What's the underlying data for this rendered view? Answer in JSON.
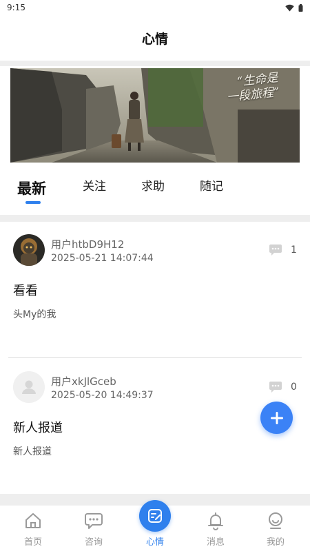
{
  "status_bar": {
    "time": "9:15",
    "wifi_icon": "wifi-icon",
    "battery_icon": "battery-icon"
  },
  "header": {
    "title": "心情"
  },
  "banner": {
    "quote": "“生命是\n一段旅程”"
  },
  "tabs": [
    {
      "label": "最新",
      "active": true
    },
    {
      "label": "关注",
      "active": false
    },
    {
      "label": "求助",
      "active": false
    },
    {
      "label": "随记",
      "active": false
    }
  ],
  "posts": [
    {
      "user": "用户htbD9H12",
      "time": "2025-05-21 14:07:44",
      "comments": "1",
      "title": "看看",
      "content": "头My的我",
      "avatar": "character-avatar"
    },
    {
      "user": "用户xkJlGceb",
      "time": "2025-05-20 14:49:37",
      "comments": "0",
      "title": "新人报道",
      "content": "新人报道",
      "avatar": "default-avatar"
    }
  ],
  "fab": {
    "icon": "plus-icon"
  },
  "bottom_nav": [
    {
      "label": "首页",
      "icon": "home-icon",
      "active": false
    },
    {
      "label": "咨询",
      "icon": "chat-icon",
      "active": false
    },
    {
      "label": "心情",
      "icon": "note-edit-icon",
      "active": true
    },
    {
      "label": "消息",
      "icon": "bell-icon",
      "active": false
    },
    {
      "label": "我的",
      "icon": "profile-icon",
      "active": false
    }
  ],
  "colors": {
    "accent": "#2f80ed",
    "fab": "#3b82f6",
    "text_muted": "#666666",
    "nav_inactive": "#999999"
  }
}
